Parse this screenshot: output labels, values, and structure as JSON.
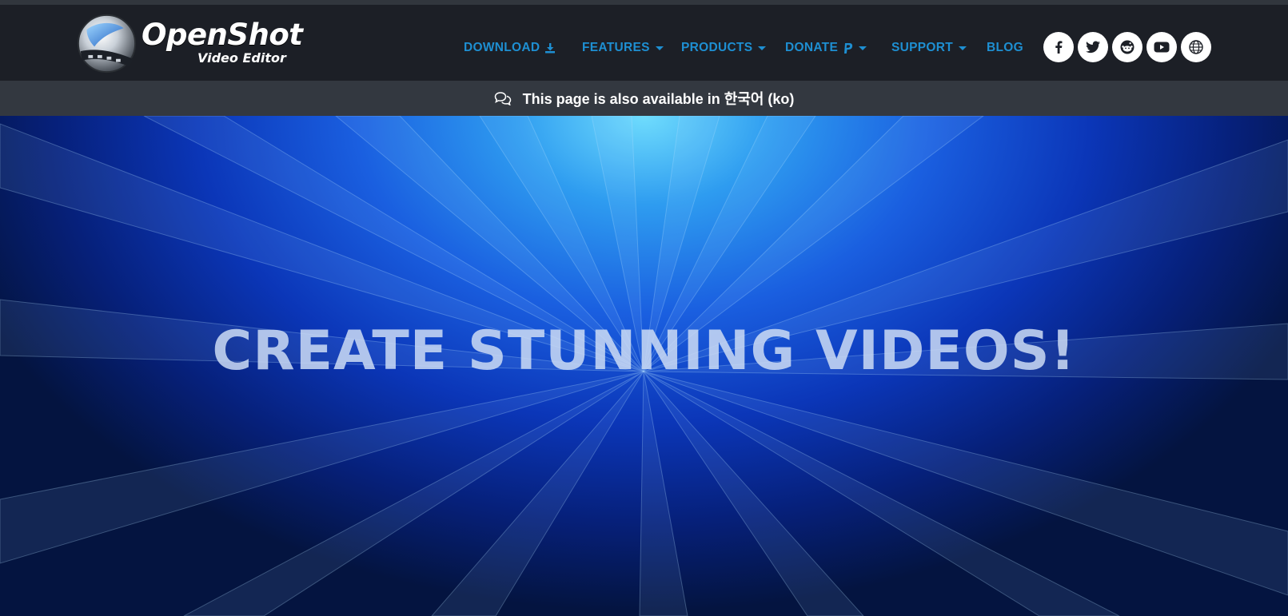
{
  "logo": {
    "name": "OpenShot",
    "subtitle": "Video Editor"
  },
  "nav": {
    "download": "DOWNLOAD",
    "features": "FEATURES",
    "products": "PRODUCTS",
    "donate": "DONATE",
    "support": "SUPPORT",
    "blog": "BLOG"
  },
  "social": [
    "facebook-icon",
    "twitter-icon",
    "reddit-icon",
    "youtube-icon",
    "globe-icon"
  ],
  "language_notice": "This page is also available in 한국어 (ko)",
  "hero": {
    "title": "CREATE STUNNING VIDEOS!"
  },
  "colors": {
    "nav_link": "#1e8fd2",
    "navbar_bg": "#1c1f26",
    "langbar_bg": "#333840"
  }
}
